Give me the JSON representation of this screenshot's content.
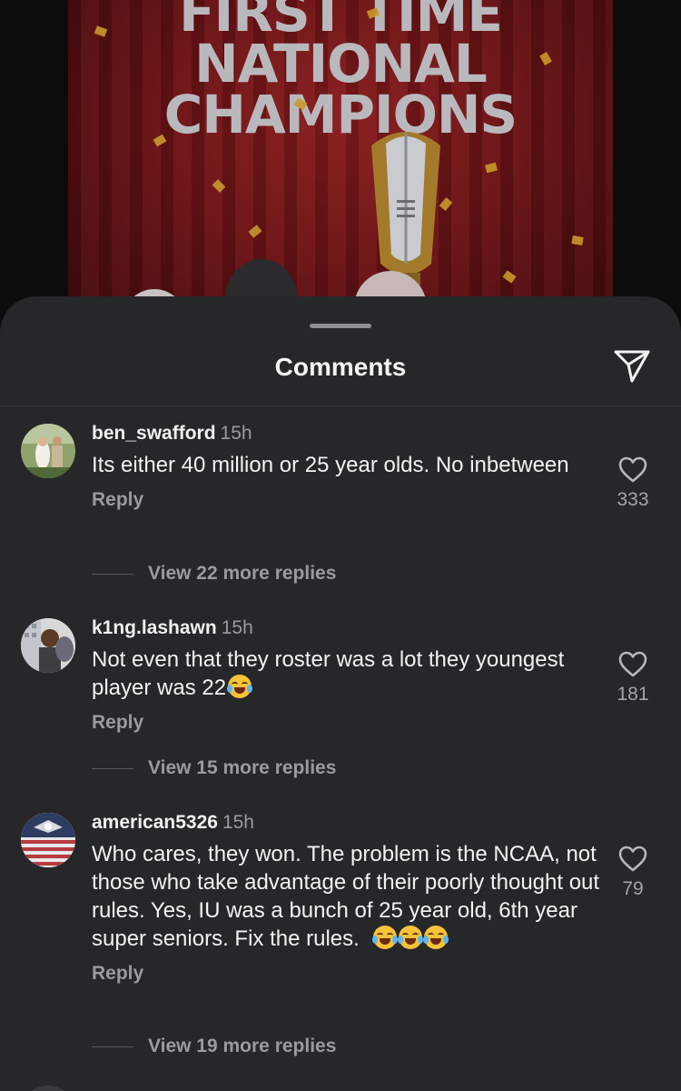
{
  "post": {
    "title_lines": [
      "FIRST TIME",
      "NATIONAL",
      "CHAMPIONS"
    ]
  },
  "sheet": {
    "title": "Comments",
    "share_icon": "paper-plane-icon"
  },
  "comments": [
    {
      "username": "ben_swafford",
      "time": "15h",
      "text": "Its either 40 million or 25 year olds. No inbetween",
      "reply_label": "Reply",
      "view_replies": "View 22 more replies",
      "likes": "333"
    },
    {
      "username": "k1ng.lashawn",
      "time": "15h",
      "text": "Not even that they roster was a lot they youngest player was 22",
      "emoji": "loudly-crying-face",
      "reply_label": "Reply",
      "view_replies": "View 15 more replies",
      "likes": "181"
    },
    {
      "username": "american5326",
      "time": "15h",
      "text": "Who cares, they won. The problem is the NCAA, not those who take advantage of their poorly thought out rules. Yes, IU was a bunch of 25 year old, 6th year super seniors. Fix the rules.",
      "emoji": "face-with-tears-of-joy x3",
      "reply_label": "Reply",
      "view_replies": "View 19 more replies",
      "likes": "79"
    }
  ],
  "colors": {
    "sheet_bg": "#262729",
    "text_primary": "#f2f2f2",
    "text_secondary": "#9a9a9f",
    "post_red": "#6c1315"
  }
}
